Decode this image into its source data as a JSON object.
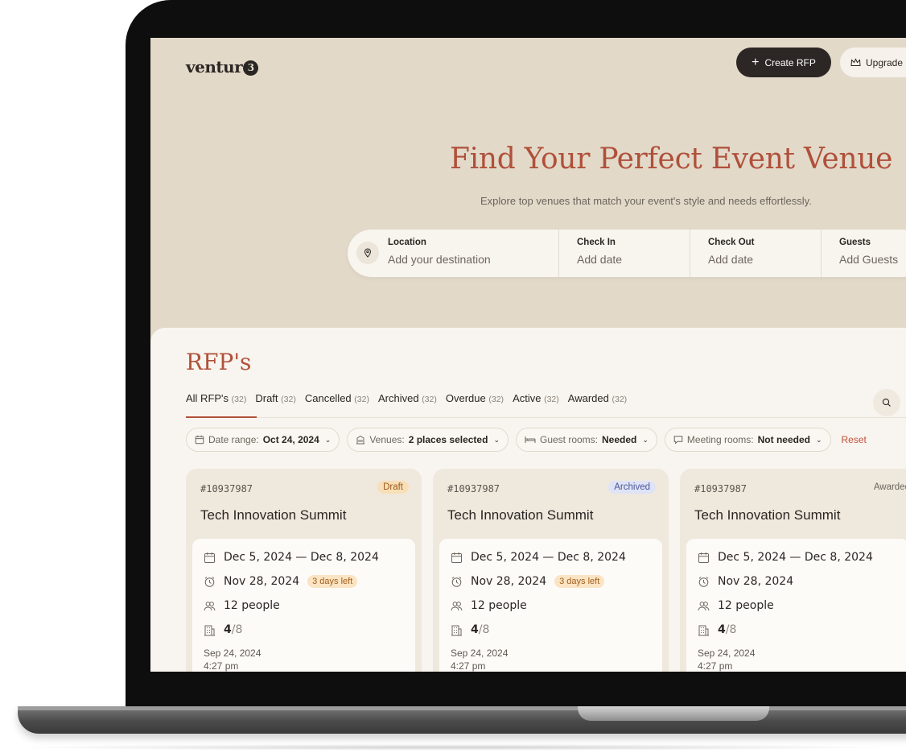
{
  "app": {
    "logo_text": "ventur",
    "logo_badge": "3"
  },
  "header": {
    "create_label": "Create RFP",
    "upgrade_label": "Upgrade"
  },
  "hero": {
    "title": "Find Your Perfect Event Venue",
    "subtitle": "Explore top venues that match your event's style and needs effortlessly."
  },
  "search": {
    "location": {
      "label": "Location",
      "placeholder": "Add your destination"
    },
    "checkin": {
      "label": "Check In",
      "placeholder": "Add date"
    },
    "checkout": {
      "label": "Check Out",
      "placeholder": "Add date"
    },
    "guests": {
      "label": "Guests",
      "placeholder": "Add Guests"
    }
  },
  "rfps": {
    "title": "RFP's",
    "tabs": [
      {
        "label": "All RFP's",
        "count": "(32)"
      },
      {
        "label": "Draft",
        "count": "(32)"
      },
      {
        "label": "Cancelled",
        "count": "(32)"
      },
      {
        "label": "Archived",
        "count": "(32)"
      },
      {
        "label": "Overdue",
        "count": "(32)"
      },
      {
        "label": "Active",
        "count": "(32)"
      },
      {
        "label": "Awarded",
        "count": "(32)"
      }
    ],
    "filters": {
      "date": {
        "key": "Date range:",
        "value": "Oct 24, 2024"
      },
      "venues": {
        "key": "Venues:",
        "value": "2 places selected"
      },
      "guest_rooms": {
        "key": "Guest rooms:",
        "value": "Needed"
      },
      "meeting_rooms": {
        "key": "Meeting rooms:",
        "value": "Not needed"
      },
      "reset_label": "Reset"
    },
    "cards": [
      {
        "id": "#10937987",
        "status": "Draft",
        "name": "Tech Innovation Summit",
        "dates": "Dec 5, 2024 — Dec 8, 2024",
        "deadline": "Nov 28, 2024",
        "days_left": "3 days left",
        "people": "12 people",
        "venues_selected": "4",
        "venues_total": "/8",
        "created_date": "Sep 24, 2024",
        "created_time": "4:27 pm"
      },
      {
        "id": "#10937987",
        "status": "Archived",
        "name": "Tech Innovation Summit",
        "dates": "Dec 5, 2024 — Dec 8, 2024",
        "deadline": "Nov 28, 2024",
        "days_left": "3 days left",
        "people": "12 people",
        "venues_selected": "4",
        "venues_total": "/8",
        "created_date": "Sep 24, 2024",
        "created_time": "4:27 pm"
      },
      {
        "id": "#10937987",
        "status": "Awarded",
        "name": "Tech Innovation Summit",
        "dates": "Dec 5, 2024 — Dec 8, 2024",
        "deadline": "Nov 28, 2024",
        "days_left": "",
        "people": "12 people",
        "venues_selected": "4",
        "venues_total": "/8",
        "created_date": "Sep 24, 2024",
        "created_time": "4:27 pm"
      }
    ]
  },
  "colors": {
    "accent": "#b0503a",
    "background": "#e2d9c9",
    "panel": "#f8f4ef"
  }
}
